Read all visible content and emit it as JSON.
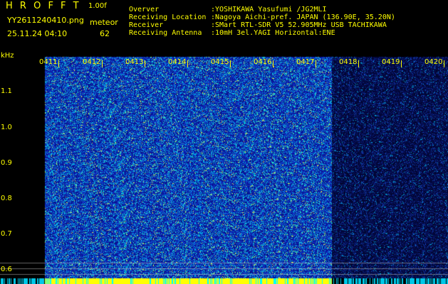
{
  "header": {
    "app_name": "H R O F F T",
    "version": "1.00f",
    "file_name": "YY2611240410.png",
    "mode": "meteor",
    "datetime": "25.11.24 04:10",
    "count": "62"
  },
  "info": {
    "observer_label": "Overver",
    "observer_value": ":YOSHIKAWA Yasufumi /JG2MLI",
    "location_label": "Receiving Location",
    "location_value": ":Nagoya Aichi-pref. JAPAN (136.90E, 35.20N)",
    "receiver_label": "Receiver",
    "receiver_value": ":SMart RTL-SDR V5 52.905MHz USB TACHIKAWA",
    "antenna_label": "Receiving Antenna",
    "antenna_value": ":10mH 3el.YAGI Horizontal:ENE"
  },
  "axis": {
    "unit": "kHz",
    "y_ticks": [
      "1.1",
      "1.0",
      "0.9",
      "0.8",
      "0.7",
      "0.6"
    ],
    "x_ticks": [
      "0411",
      "0412",
      "0413",
      "0414",
      "0415",
      "0416",
      "0417",
      "0418",
      "0419",
      "0420"
    ]
  },
  "colors": {
    "label": "#ffff00",
    "background": "#000000",
    "noise_base": "#0a1a8a",
    "noise_hi": "#00ffff",
    "bar": "#ffff00"
  }
}
